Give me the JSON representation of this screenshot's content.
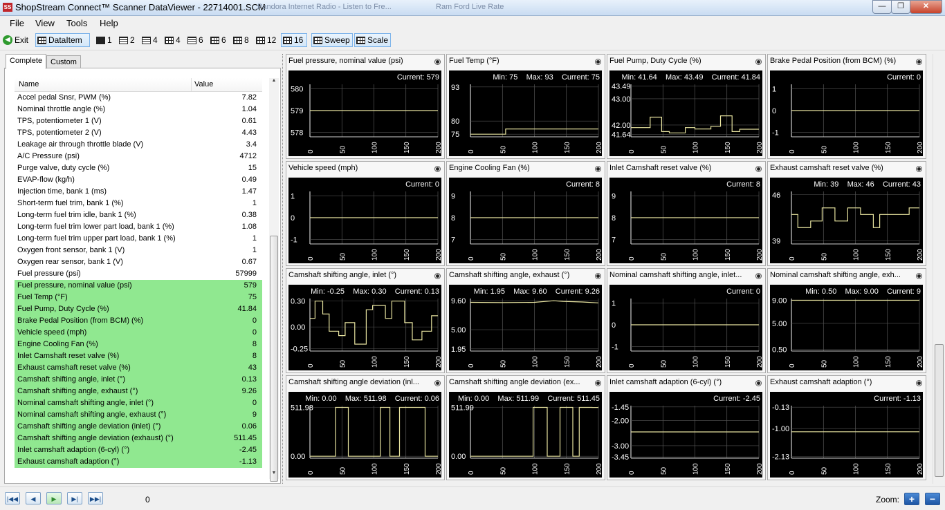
{
  "window": {
    "title": "ShopStream Connect™ Scanner DataViewer - 22714001.SCM",
    "app_icon_text": "SS",
    "ghost_tabs": [
      "Pandora Internet Radio - Listen to Fre...",
      "Ram Ford Live Rate"
    ],
    "controls": {
      "minimize": "—",
      "maximize": "❐",
      "close": "✕"
    }
  },
  "menu": [
    "File",
    "View",
    "Tools",
    "Help"
  ],
  "toolbar": {
    "exit": "Exit",
    "dataitem": "DataItem",
    "layouts": [
      "1",
      "2",
      "4",
      "4",
      "6",
      "6",
      "8",
      "12",
      "16"
    ],
    "sweep": "Sweep",
    "scale": "Scale",
    "selected_layout": "16"
  },
  "left": {
    "tabs": [
      "Complete",
      "Custom"
    ],
    "headers": {
      "name": "Name",
      "value": "Value"
    },
    "rows": [
      {
        "name": "Accel pedal Snsr, PWM (%)",
        "value": "7.82",
        "hl": false
      },
      {
        "name": "Nominal throttle angle (%)",
        "value": "1.04",
        "hl": false
      },
      {
        "name": "TPS, potentiometer 1 (V)",
        "value": "0.61",
        "hl": false
      },
      {
        "name": "TPS, potentiometer 2 (V)",
        "value": "4.43",
        "hl": false
      },
      {
        "name": "Leakage air through throttle blade (V)",
        "value": "3.4",
        "hl": false
      },
      {
        "name": "A/C Pressure (psi)",
        "value": "4712",
        "hl": false
      },
      {
        "name": "Purge valve, duty cycle (%)",
        "value": "15",
        "hl": false
      },
      {
        "name": "EVAP-flow (kg/h)",
        "value": "0.49",
        "hl": false
      },
      {
        "name": "Injection time, bank 1 (ms)",
        "value": "1.47",
        "hl": false
      },
      {
        "name": "Short-term fuel trim, bank 1 (%)",
        "value": "1",
        "hl": false
      },
      {
        "name": "Long-term fuel trim idle, bank 1 (%)",
        "value": "0.38",
        "hl": false
      },
      {
        "name": "Long-term fuel trim lower part load, bank 1 (%)",
        "value": "1.08",
        "hl": false
      },
      {
        "name": "Long-term fuel trim upper part load, bank 1 (%)",
        "value": "1",
        "hl": false
      },
      {
        "name": "Oxygen front sensor, bank 1 (V)",
        "value": "1",
        "hl": false
      },
      {
        "name": "Oxygen rear sensor, bank 1 (V)",
        "value": "0.67",
        "hl": false
      },
      {
        "name": "Fuel pressure (psi)",
        "value": "57999",
        "hl": false
      },
      {
        "name": "Fuel pressure, nominal value (psi)",
        "value": "579",
        "hl": true
      },
      {
        "name": "Fuel Temp (°F)",
        "value": "75",
        "hl": true
      },
      {
        "name": "Fuel Pump, Duty Cycle (%)",
        "value": "41.84",
        "hl": true
      },
      {
        "name": "Brake Pedal Position (from BCM) (%)",
        "value": "0",
        "hl": true
      },
      {
        "name": "Vehicle speed (mph)",
        "value": "0",
        "hl": true
      },
      {
        "name": "Engine Cooling Fan (%)",
        "value": "8",
        "hl": true
      },
      {
        "name": "Inlet Camshaft reset valve (%)",
        "value": "8",
        "hl": true
      },
      {
        "name": "Exhaust camshaft reset valve (%)",
        "value": "43",
        "hl": true
      },
      {
        "name": "Camshaft shifting angle, inlet (°)",
        "value": "0.13",
        "hl": true
      },
      {
        "name": "Camshaft shifting angle, exhaust (°)",
        "value": "9.26",
        "hl": true
      },
      {
        "name": "Nominal camshaft shifting angle, inlet (°)",
        "value": "0",
        "hl": true
      },
      {
        "name": "Nominal camshaft shifting angle, exhaust (°)",
        "value": "9",
        "hl": true
      },
      {
        "name": "Camshaft shifting angle deviation (inlet) (°)",
        "value": "0.06",
        "hl": true
      },
      {
        "name": "Camshaft shifting angle deviation (exhaust) (°)",
        "value": "511.45",
        "hl": true
      },
      {
        "name": "Inlet camshaft adaption (6-cyl) (°)",
        "value": "-2.45",
        "hl": true
      },
      {
        "name": "Exhaust camshaft adaption (°)",
        "value": "-1.13",
        "hl": true
      }
    ]
  },
  "chart_data": [
    {
      "type": "line",
      "title": "Fuel pressure, nominal value (psi)",
      "stats": "Current: 579",
      "yticks": [
        "580",
        "579",
        "578"
      ],
      "ylim": [
        577.8,
        580.2
      ],
      "ytick_vals": [
        580,
        579,
        578
      ],
      "xticks": [
        "0",
        "50",
        "100",
        "150",
        "200"
      ],
      "x": [
        0,
        200
      ],
      "y": [
        579,
        579
      ]
    },
    {
      "type": "line",
      "title": "Fuel Temp (°F)",
      "stats": "Min: 75    Max: 93    Current: 75",
      "yticks": [
        "93",
        "80",
        "75"
      ],
      "ylim": [
        74,
        94
      ],
      "ytick_vals": [
        93,
        80,
        75
      ],
      "xticks": [
        "0",
        "50",
        "100",
        "150",
        "200"
      ],
      "x": [
        0,
        55,
        55,
        200
      ],
      "y": [
        75,
        75,
        77,
        77
      ]
    },
    {
      "type": "line",
      "title": "Fuel Pump, Duty Cycle (%)",
      "stats": "Min: 41.64    Max: 43.49    Current: 41.84",
      "yticks": [
        "43.49",
        "43.00",
        "42.00",
        "41.64"
      ],
      "ylim": [
        41.55,
        43.55
      ],
      "ytick_vals": [
        43.49,
        43.0,
        42.0,
        41.64
      ],
      "xticks": [
        "0",
        "50",
        "100",
        "150",
        "200"
      ],
      "x": [
        0,
        30,
        30,
        48,
        48,
        60,
        60,
        85,
        85,
        100,
        100,
        125,
        125,
        140,
        140,
        158,
        158,
        170,
        170,
        200
      ],
      "y": [
        41.9,
        41.9,
        42.3,
        42.3,
        41.75,
        41.75,
        41.7,
        41.7,
        41.9,
        41.9,
        41.85,
        41.85,
        41.95,
        41.95,
        42.35,
        42.35,
        41.75,
        41.75,
        41.84,
        41.84
      ]
    },
    {
      "type": "line",
      "title": "Brake Pedal Position (from BCM) (%)",
      "stats": "Current: 0",
      "yticks": [
        "1",
        "0",
        "-1"
      ],
      "ylim": [
        -1.2,
        1.2
      ],
      "ytick_vals": [
        1,
        0,
        -1
      ],
      "xticks": [
        "0",
        "50",
        "100",
        "150",
        "200"
      ],
      "x": [
        0,
        200
      ],
      "y": [
        0,
        0
      ]
    },
    {
      "type": "line",
      "title": "Vehicle speed (mph)",
      "stats": "Current: 0",
      "yticks": [
        "1",
        "0",
        "-1"
      ],
      "ylim": [
        -1.2,
        1.2
      ],
      "ytick_vals": [
        1,
        0,
        -1
      ],
      "xticks": [
        "0",
        "50",
        "100",
        "150",
        "200"
      ],
      "x": [
        0,
        200
      ],
      "y": [
        0,
        0
      ]
    },
    {
      "type": "line",
      "title": "Engine Cooling Fan (%)",
      "stats": "Current: 8",
      "yticks": [
        "9",
        "8",
        "7"
      ],
      "ylim": [
        6.8,
        9.2
      ],
      "ytick_vals": [
        9,
        8,
        7
      ],
      "xticks": [
        "0",
        "50",
        "100",
        "150",
        "200"
      ],
      "x": [
        0,
        200
      ],
      "y": [
        8,
        8
      ]
    },
    {
      "type": "line",
      "title": "Inlet Camshaft reset valve (%)",
      "stats": "Current: 8",
      "yticks": [
        "9",
        "8",
        "7"
      ],
      "ylim": [
        6.8,
        9.2
      ],
      "ytick_vals": [
        9,
        8,
        7
      ],
      "xticks": [
        "0",
        "50",
        "100",
        "150",
        "200"
      ],
      "x": [
        0,
        200
      ],
      "y": [
        8,
        8
      ]
    },
    {
      "type": "line",
      "title": "Exhaust camshaft reset valve (%)",
      "stats": "Min: 39    Max: 46    Current: 43",
      "yticks": [
        "46",
        "39"
      ],
      "ylim": [
        38.5,
        46.5
      ],
      "ytick_vals": [
        46,
        39
      ],
      "xticks": [
        "0",
        "50",
        "100",
        "150",
        "200"
      ],
      "x": [
        0,
        10,
        10,
        30,
        30,
        48,
        48,
        68,
        68,
        88,
        88,
        108,
        108,
        128,
        128,
        138,
        138,
        162,
        162,
        184,
        184,
        200
      ],
      "y": [
        43,
        43,
        41,
        41,
        42,
        42,
        44,
        44,
        42,
        42,
        44,
        44,
        43,
        43,
        41,
        41,
        43,
        43,
        43,
        43,
        44,
        44
      ]
    },
    {
      "type": "line",
      "title": "Camshaft shifting angle, inlet (°)",
      "stats": "Min: -0.25    Max: 0.30    Current: 0.13",
      "yticks": [
        "0.30",
        "0.00",
        "-0.25"
      ],
      "ylim": [
        -0.28,
        0.33
      ],
      "ytick_vals": [
        0.3,
        0.0,
        -0.25
      ],
      "xticks": [
        "0",
        "50",
        "100",
        "150",
        "200"
      ],
      "x": [
        0,
        8,
        8,
        20,
        20,
        30,
        30,
        45,
        45,
        55,
        55,
        70,
        70,
        88,
        88,
        98,
        98,
        118,
        118,
        128,
        128,
        148,
        148,
        160,
        160,
        175,
        175,
        190,
        190,
        200
      ],
      "y": [
        0.1,
        0.1,
        0.3,
        0.3,
        0.15,
        0.15,
        -0.05,
        -0.05,
        -0.1,
        -0.1,
        0.05,
        0.05,
        -0.2,
        -0.2,
        0.2,
        0.2,
        0.25,
        0.25,
        0.1,
        0.1,
        0.3,
        0.3,
        0.05,
        0.05,
        -0.15,
        -0.15,
        -0.05,
        -0.05,
        0.13,
        0.13
      ]
    },
    {
      "type": "line",
      "title": "Camshaft shifting angle, exhaust (°)",
      "stats": "Min: 1.95    Max: 9.60    Current: 9.26",
      "yticks": [
        "9.60",
        "5.00",
        "1.95"
      ],
      "ylim": [
        1.6,
        9.95
      ],
      "ytick_vals": [
        9.6,
        5.0,
        1.95
      ],
      "xticks": [
        "0",
        "50",
        "100",
        "150",
        "200"
      ],
      "x": [
        0,
        50,
        100,
        130,
        145,
        175,
        200
      ],
      "y": [
        9.35,
        9.3,
        9.35,
        9.6,
        9.5,
        9.4,
        9.26
      ]
    },
    {
      "type": "line",
      "title": "Nominal camshaft shifting angle, inlet...",
      "stats": "Current: 0",
      "yticks": [
        "1",
        "0",
        "-1"
      ],
      "ylim": [
        -1.2,
        1.2
      ],
      "ytick_vals": [
        1,
        0,
        -1
      ],
      "xticks": [
        "0",
        "50",
        "100",
        "150",
        "200"
      ],
      "x": [
        0,
        200
      ],
      "y": [
        0,
        0
      ]
    },
    {
      "type": "line",
      "title": "Nominal camshaft shifting angle, exh...",
      "stats": "Min: 0.50    Max: 9.00    Current: 9",
      "yticks": [
        "9.00",
        "5.00",
        "0.50"
      ],
      "ylim": [
        0.2,
        9.3
      ],
      "ytick_vals": [
        9.0,
        5.0,
        0.5
      ],
      "xticks": [
        "0",
        "50",
        "100",
        "150",
        "200"
      ],
      "x": [
        0,
        200
      ],
      "y": [
        9,
        9
      ]
    },
    {
      "type": "line",
      "title": "Camshaft shifting angle deviation (inl...",
      "stats": "Min: 0.00    Max: 511.98    Current: 0.06",
      "yticks": [
        "511.98",
        "0.00"
      ],
      "ylim": [
        -20,
        530
      ],
      "ytick_vals": [
        511.98,
        0
      ],
      "xticks": [
        "0",
        "50",
        "100",
        "150",
        "200"
      ],
      "x": [
        0,
        40,
        40,
        60,
        60,
        110,
        110,
        125,
        125,
        140,
        140,
        158,
        158,
        180,
        180,
        200
      ],
      "y": [
        0,
        0,
        511.98,
        511.98,
        0,
        0,
        511.98,
        511.98,
        0,
        0,
        511.98,
        511.98,
        511.98,
        511.98,
        0,
        0
      ]
    },
    {
      "type": "line",
      "title": "Camshaft shifting angle deviation (ex...",
      "stats": "Min: 0.00    Max: 511.99    Current: 511.45",
      "yticks": [
        "511.99",
        "0.00"
      ],
      "ylim": [
        -20,
        530
      ],
      "ytick_vals": [
        511.99,
        0
      ],
      "xticks": [
        "0",
        "50",
        "100",
        "150",
        "200"
      ],
      "x": [
        0,
        98,
        98,
        120,
        120,
        140,
        140,
        160,
        160,
        170,
        170,
        190,
        190,
        200
      ],
      "y": [
        0,
        0,
        511.99,
        511.99,
        0,
        0,
        511.99,
        511.99,
        0,
        0,
        511.99,
        511.99,
        511.45,
        511.45
      ]
    },
    {
      "type": "line",
      "title": "Inlet camshaft adaption (6-cyl) (°)",
      "stats": "Current: -2.45",
      "yticks": [
        "-1.45",
        "-2.00",
        "-3.00",
        "-3.45"
      ],
      "ylim": [
        -3.5,
        -1.4
      ],
      "ytick_vals": [
        -1.45,
        -2.0,
        -3.0,
        -3.45
      ],
      "xticks": [
        "0",
        "50",
        "100",
        "150",
        "200"
      ],
      "x": [
        0,
        200
      ],
      "y": [
        -2.45,
        -2.45
      ]
    },
    {
      "type": "line",
      "title": "Exhaust camshaft adaption (°)",
      "stats": "Current: -1.13",
      "yticks": [
        "-0.13",
        "-1.00",
        "-2.13"
      ],
      "ylim": [
        -2.2,
        -0.07
      ],
      "ytick_vals": [
        -0.13,
        -1.0,
        -2.13
      ],
      "xticks": [
        "0",
        "50",
        "100",
        "150",
        "200"
      ],
      "x": [
        0,
        200
      ],
      "y": [
        -1.13,
        -1.13
      ]
    }
  ],
  "bottom": {
    "nav": [
      "|◀◀",
      "◀",
      "▶",
      "▶|",
      "▶▶|"
    ],
    "position": "0",
    "zoom_label": "Zoom:",
    "zoom_in": "+",
    "zoom_out": "−"
  },
  "colors": {
    "trace": "#e8e4a0",
    "highlight": "#90e890",
    "plot_bg": "#000000"
  }
}
